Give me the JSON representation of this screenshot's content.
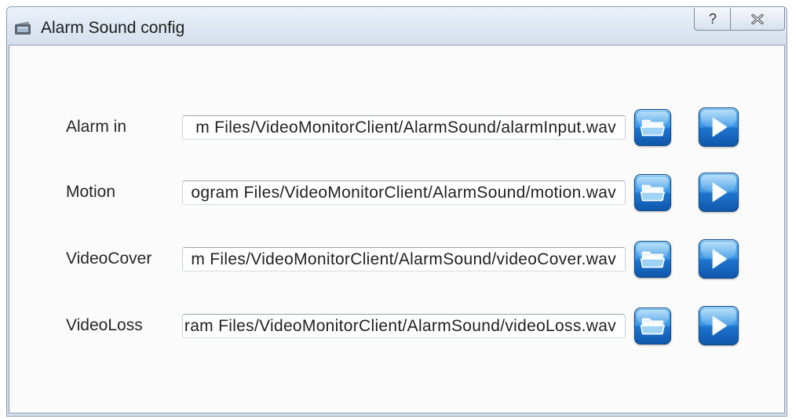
{
  "window": {
    "title": "Alarm Sound config",
    "help_glyph": "?"
  },
  "icons": {
    "app": "app-icon",
    "help": "help-icon",
    "close": "close-icon",
    "browse": "folder-open-icon",
    "play": "play-icon"
  },
  "rows": [
    {
      "label": "Alarm in",
      "path": "m Files/VideoMonitorClient/AlarmSound/alarmInput.wav"
    },
    {
      "label": "Motion",
      "path": "ogram Files/VideoMonitorClient/AlarmSound/motion.wav"
    },
    {
      "label": "VideoCover",
      "path": "m Files/VideoMonitorClient/AlarmSound/videoCover.wav"
    },
    {
      "label": "VideoLoss",
      "path": "ram Files/VideoMonitorClient/AlarmSound/videoLoss.wav"
    }
  ],
  "colors": {
    "frame": "#d5e0ed",
    "button_light": "#62b8f3",
    "button_dark": "#0f57ab",
    "button_border": "#0a4788"
  }
}
